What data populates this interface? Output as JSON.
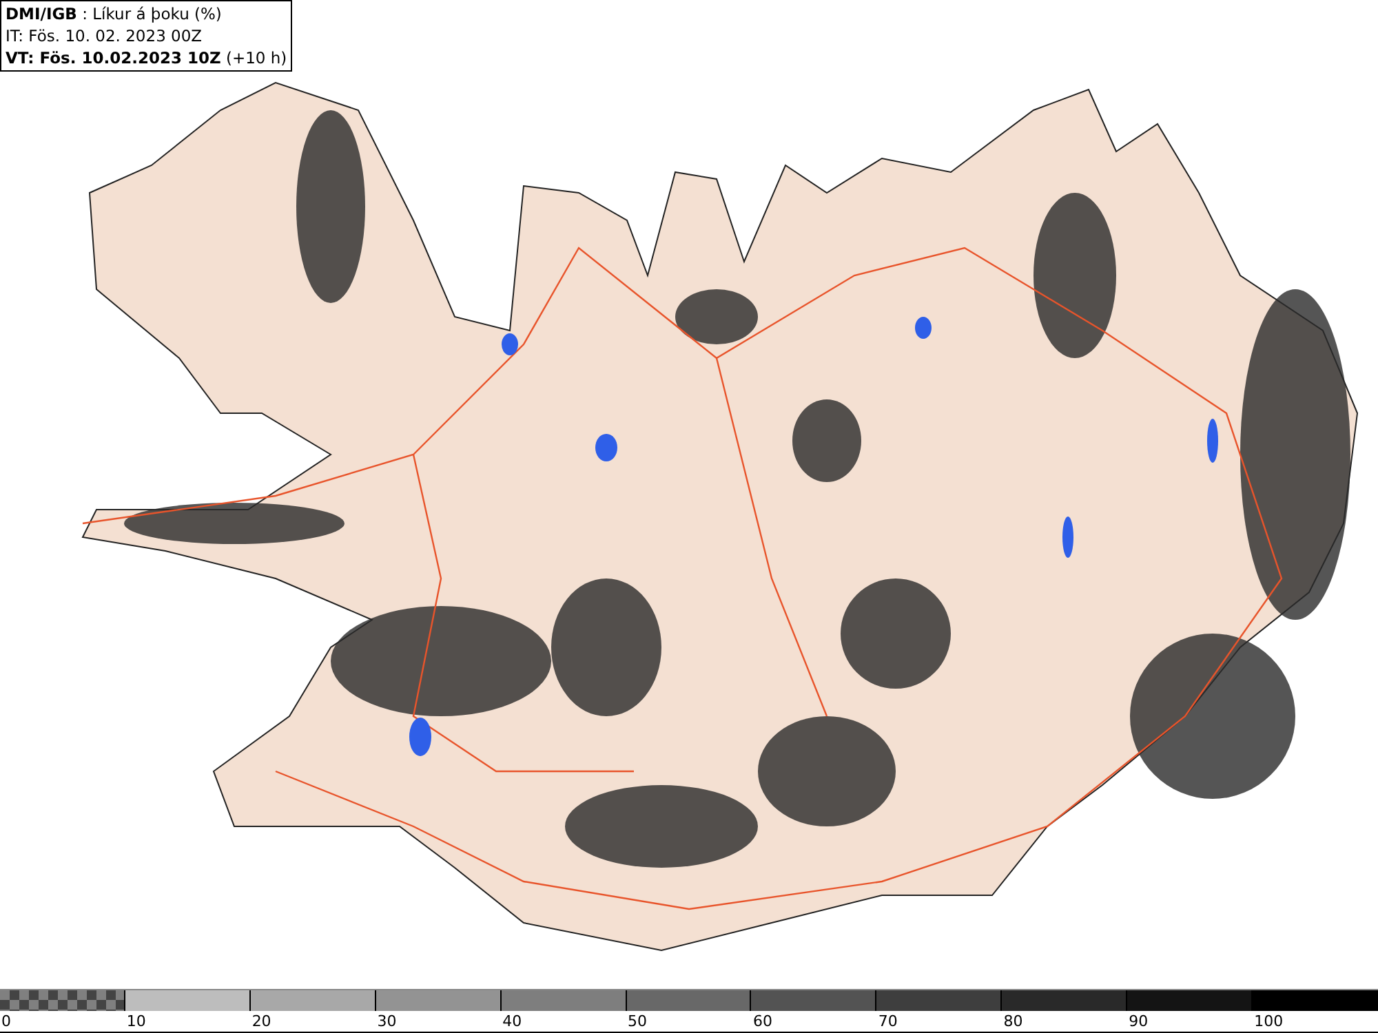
{
  "legend": {
    "title": "**DMI/IGB** : Líkur á þoku (%)",
    "issue_time": "IT: Fös. 10. 02. 2023 00Z",
    "valid_time": "**VT: Fös. 10.02.2023 10Z** (+10 h)"
  },
  "colorbar": {
    "segments": [
      {
        "kind": "checker",
        "color": "#808080"
      },
      {
        "kind": "solid",
        "color": "#bdbdbd"
      },
      {
        "kind": "solid",
        "color": "#a8a8a8"
      },
      {
        "kind": "solid",
        "color": "#939393"
      },
      {
        "kind": "solid",
        "color": "#7e7e7e"
      },
      {
        "kind": "solid",
        "color": "#686868"
      },
      {
        "kind": "solid",
        "color": "#535353"
      },
      {
        "kind": "solid",
        "color": "#3e3e3e"
      },
      {
        "kind": "solid",
        "color": "#292929"
      },
      {
        "kind": "solid",
        "color": "#141414"
      },
      {
        "kind": "solid",
        "color": "#000000"
      }
    ],
    "labels": [
      "0",
      "10",
      "20",
      "30",
      "40",
      "50",
      "60",
      "70",
      "80",
      "90",
      "100"
    ]
  }
}
